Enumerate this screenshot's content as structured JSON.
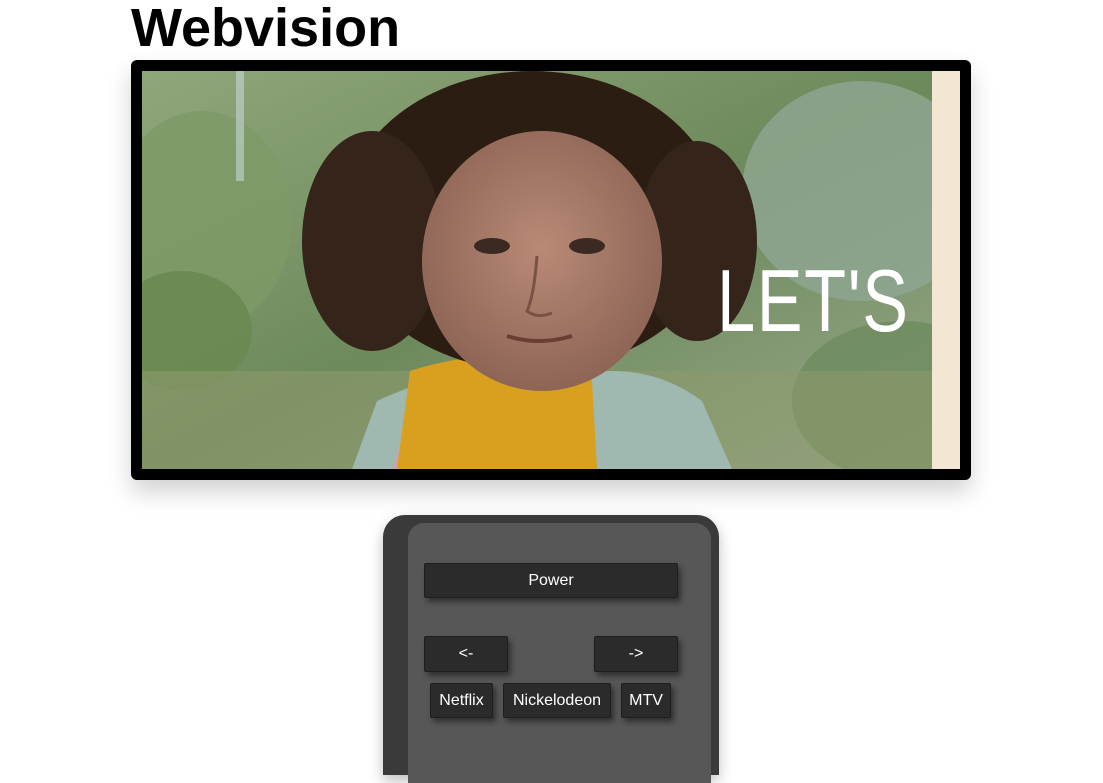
{
  "header": {
    "title": "Webvision"
  },
  "tv": {
    "screen": {
      "content": "video-frame",
      "caption": "LET'S"
    }
  },
  "remote": {
    "power_label": "Power",
    "prev_label": "<-",
    "next_label": "->",
    "channels": [
      {
        "label": "Netflix"
      },
      {
        "label": "Nickelodeon"
      },
      {
        "label": "MTV"
      }
    ]
  },
  "colors": {
    "tv_frame": "#000000",
    "remote_body": "#3a3a3a",
    "remote_face": "#575757",
    "button_bg": "#2b2b2b",
    "button_text": "#ffffff"
  }
}
